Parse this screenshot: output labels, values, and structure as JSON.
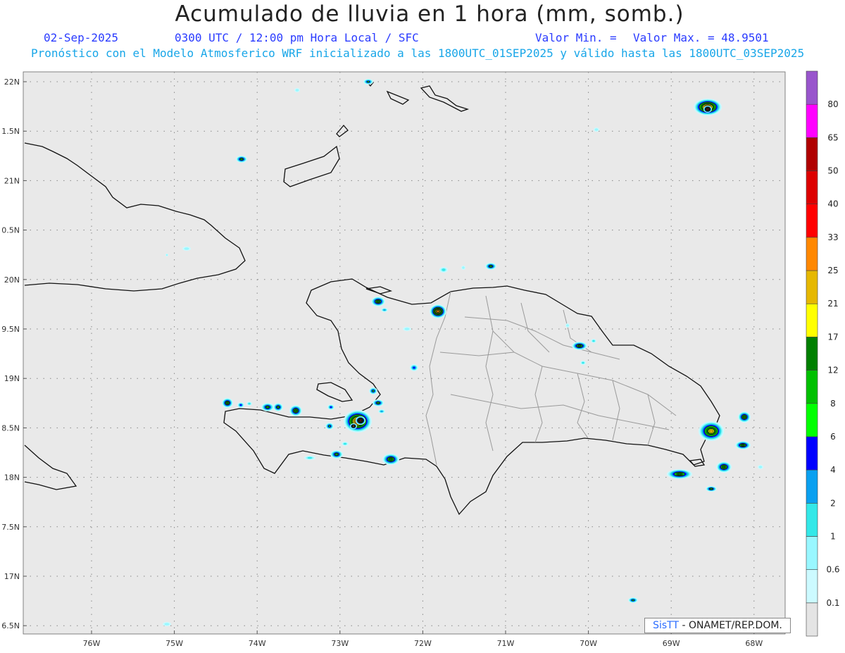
{
  "header": {
    "title": "Acumulado de lluvia en 1 hora (mm, somb.)",
    "date": "02-Sep-2025",
    "time": "0300 UTC / 12:00 pm Hora Local / SFC",
    "min_label": "Valor Min. =",
    "max_label": "Valor Max. = 48.9501",
    "model_line": "Pronóstico con el Modelo Atmosferico WRF inicializado a las 1800UTC_01SEP2025 y válido hasta las  1800UTC_03SEP2025"
  },
  "map": {
    "lat_ticks": [
      "22N",
      "1.5N",
      "21N",
      "0.5N",
      "20N",
      "9.5N",
      "19N",
      "8.5N",
      "18N",
      "7.5N",
      "17N",
      "6.5N"
    ],
    "lon_ticks": [
      "76W",
      "75W",
      "74W",
      "73W",
      "72W",
      "71W",
      "70W",
      "69W",
      "68W"
    ],
    "background_color": "#e9e9e9"
  },
  "colorbar": {
    "labels": [
      "0.1",
      "0.6",
      "1",
      "2",
      "4",
      "6",
      "8",
      "12",
      "17",
      "21",
      "25",
      "33",
      "40",
      "50",
      "65",
      "80"
    ],
    "colors": [
      "#e4e4e4",
      "#ccfaff",
      "#99f7ff",
      "#33e8e8",
      "#0aa0f0",
      "#0000ff",
      "#00ff00",
      "#00c000",
      "#008000",
      "#ffff00",
      "#e6b800",
      "#ff8800",
      "#ff0000",
      "#dd0000",
      "#b00000",
      "#ff00ff",
      "#9955cc"
    ]
  },
  "credit": {
    "sis": "SisTT",
    "text": " - ONAMET/REP.DOM."
  }
}
